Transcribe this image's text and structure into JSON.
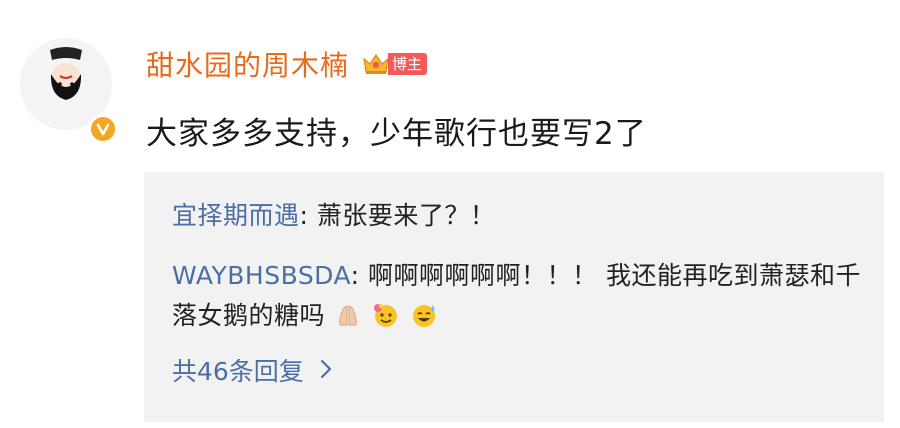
{
  "post": {
    "author": "甜水园的周木楠",
    "badge_label": "博主",
    "text": "大家多多支持，少年歌行也要写2了"
  },
  "replies": [
    {
      "user": "宜择期而遇",
      "text": ": 萧张要来了？！"
    },
    {
      "user": "WAYBHSBSDA",
      "text": ": 啊啊啊啊啊啊！！！ 我还能再吃到萧瑟和千落女鹅的糖吗"
    }
  ],
  "more_replies": "共46条回复",
  "icons": {
    "verified": "verified-v-icon",
    "crown": "crown-icon",
    "pray": "pray-emoji",
    "flower_face": "flower-face-emoji",
    "sweat_face": "sweat-smile-emoji",
    "chevron": "chevron-right-icon"
  },
  "colors": {
    "author": "#e86b1c",
    "reply_user": "#4a6fa5",
    "badge": "#f25a5a",
    "verified": "#f5a623",
    "reply_bg": "#f2f2f2"
  }
}
